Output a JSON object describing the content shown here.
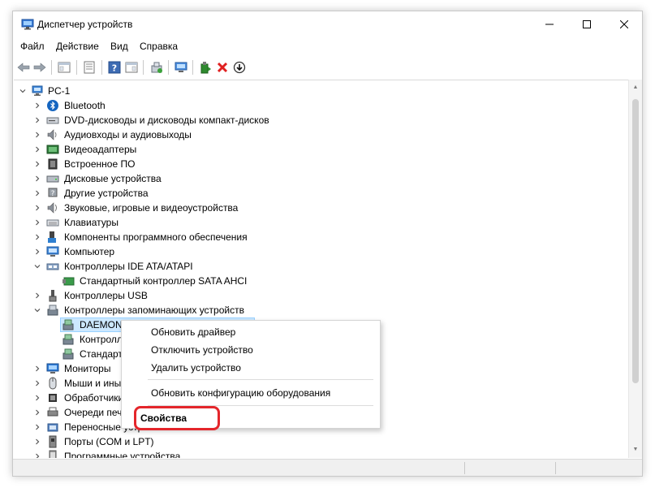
{
  "window": {
    "title": "Диспетчер устройств",
    "controls": {
      "minimize": "minimize",
      "maximize": "maximize",
      "close": "close"
    }
  },
  "menu": [
    "Файл",
    "Действие",
    "Вид",
    "Справка"
  ],
  "toolbar": [
    "back-arrow-icon",
    "forward-arrow-icon",
    "show-hide-tree-icon",
    "properties-icon",
    "help-icon",
    "view-icon",
    "update-driver-icon",
    "scan-hardware-icon",
    "add-driver-icon",
    "uninstall-icon",
    "disable-icon"
  ],
  "tree": {
    "root": "PC-1",
    "items": [
      {
        "label": "Bluetooth",
        "expanded": false,
        "icon": "bluetooth-icon"
      },
      {
        "label": "DVD-дисководы и дисководы компакт-дисков",
        "expanded": false,
        "icon": "dvd-icon"
      },
      {
        "label": "Аудиовходы и аудиовыходы",
        "expanded": false,
        "icon": "audio-icon"
      },
      {
        "label": "Видеоадаптеры",
        "expanded": false,
        "icon": "display-adapter-icon"
      },
      {
        "label": "Встроенное ПО",
        "expanded": false,
        "icon": "firmware-icon"
      },
      {
        "label": "Дисковые устройства",
        "expanded": false,
        "icon": "disk-drive-icon"
      },
      {
        "label": "Другие устройства",
        "expanded": false,
        "icon": "other-devices-icon"
      },
      {
        "label": "Звуковые, игровые и видеоустройства",
        "expanded": false,
        "icon": "sound-icon"
      },
      {
        "label": "Клавиатуры",
        "expanded": false,
        "icon": "keyboard-icon"
      },
      {
        "label": "Компоненты программного обеспечения",
        "expanded": false,
        "icon": "software-component-icon"
      },
      {
        "label": "Компьютер",
        "expanded": false,
        "icon": "computer-icon"
      },
      {
        "label": "Контроллеры IDE ATA/ATAPI",
        "expanded": true,
        "icon": "ide-controller-icon"
      },
      {
        "label": "Стандартный контроллер SATA AHCI",
        "child": true,
        "icon": "controller-icon"
      },
      {
        "label": "Контроллеры USB",
        "expanded": false,
        "icon": "usb-icon"
      },
      {
        "label": "Контроллеры запоминающих устройств",
        "expanded": true,
        "icon": "storage-controller-icon"
      },
      {
        "label": "DAEMON Tools Lite Virtual SCSI Bus",
        "child": true,
        "selected": true,
        "icon": "storage-device-icon"
      },
      {
        "label": "Контроллер пространств хранения (Майкрософт)",
        "child": true,
        "icon": "storage-device-icon"
      },
      {
        "label": "Стандартный контроллер NVM Express",
        "child": true,
        "icon": "storage-device-icon"
      },
      {
        "label": "Мониторы",
        "expanded": false,
        "icon": "monitor-icon"
      },
      {
        "label": "Мыши и иные указывающие устройства",
        "expanded": false,
        "icon": "mouse-icon"
      },
      {
        "label": "Обработчики",
        "expanded": false,
        "icon": "processor-icon"
      },
      {
        "label": "Очереди печати",
        "expanded": false,
        "icon": "printer-icon"
      },
      {
        "label": "Переносные устройства",
        "expanded": false,
        "icon": "portable-device-icon"
      },
      {
        "label": "Порты (COM и LPT)",
        "expanded": false,
        "icon": "port-icon"
      },
      {
        "label": "Программные устройства",
        "expanded": false,
        "icon": "software-device-icon"
      }
    ]
  },
  "context_menu": {
    "items": [
      {
        "label": "Обновить драйвер"
      },
      {
        "label": "Отключить устройство"
      },
      {
        "label": "Удалить устройство"
      },
      {
        "separator": true
      },
      {
        "label": "Обновить конфигурацию оборудования"
      },
      {
        "separator": true
      },
      {
        "label": "Свойства",
        "bold": true,
        "highlighted": true
      }
    ]
  },
  "colors": {
    "selection": "#cce8ff",
    "highlight_ring": "#e4262b",
    "accent": "#0078d4"
  }
}
